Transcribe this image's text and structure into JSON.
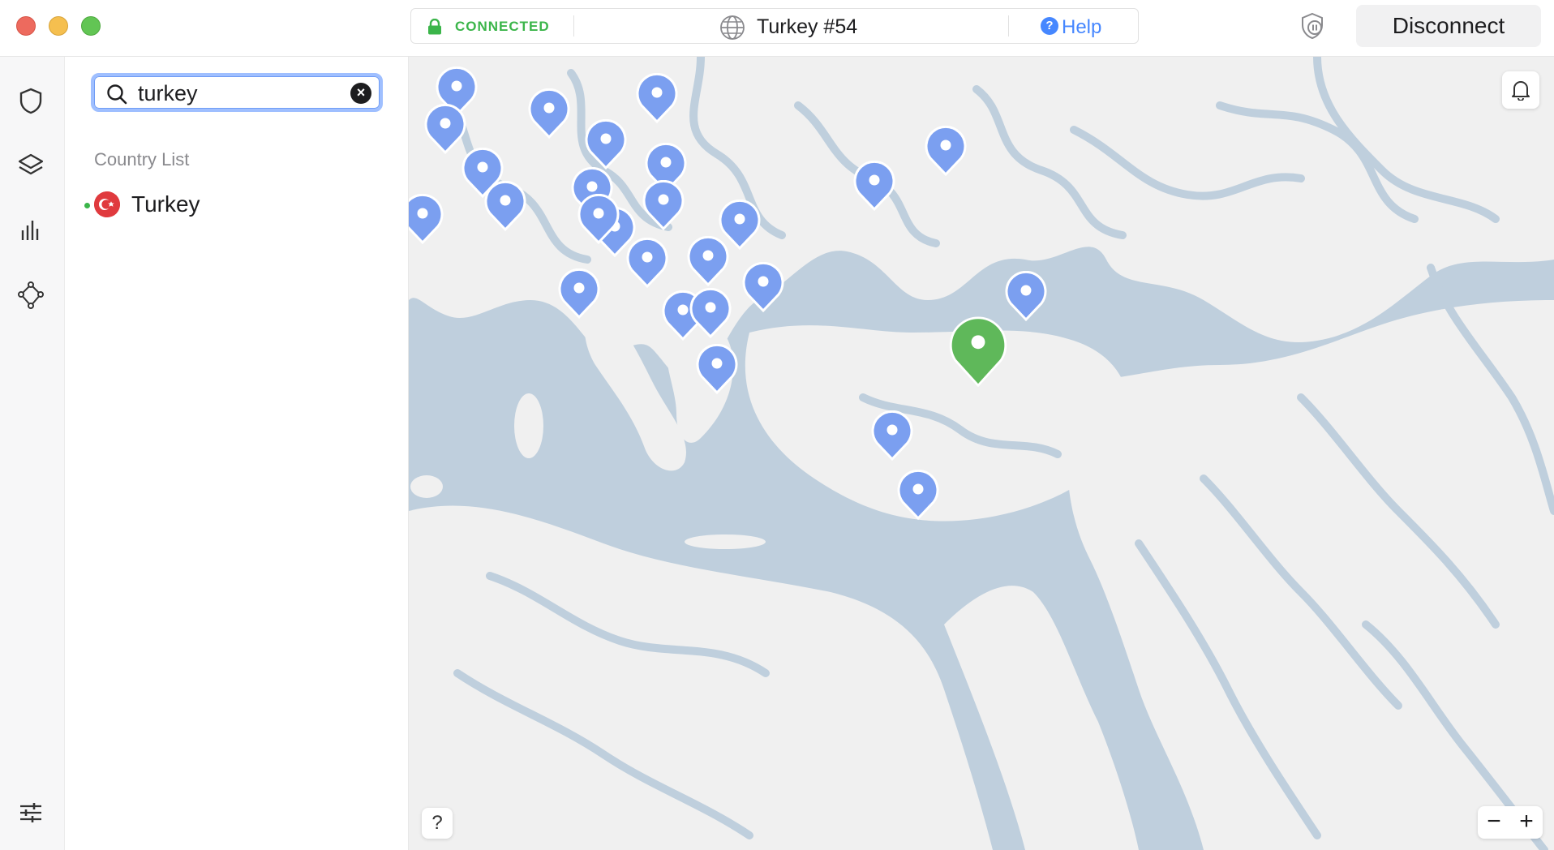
{
  "titlebar": {
    "status": "CONNECTED",
    "server": "Turkey #54",
    "help_label": "Help",
    "disconnect_label": "Disconnect"
  },
  "rail": {
    "icons": [
      "shield-icon",
      "layers-icon",
      "stats-icon",
      "meshnet-icon",
      "settings-sliders-icon"
    ]
  },
  "sidebar": {
    "search": {
      "value": "turkey",
      "placeholder": "Search"
    },
    "section_title": "Country List",
    "countries": [
      {
        "name": "Turkey",
        "connected": true
      }
    ]
  },
  "map": {
    "help_label": "?",
    "zoom_out_label": "−",
    "zoom_in_label": "+"
  },
  "colors": {
    "accent": "#4687ff",
    "connected": "#3bb54a",
    "pin": "#7b9ff0",
    "active_pin": "#5fb85a",
    "water": "#bfcfdd",
    "land": "#f0f0f0"
  }
}
